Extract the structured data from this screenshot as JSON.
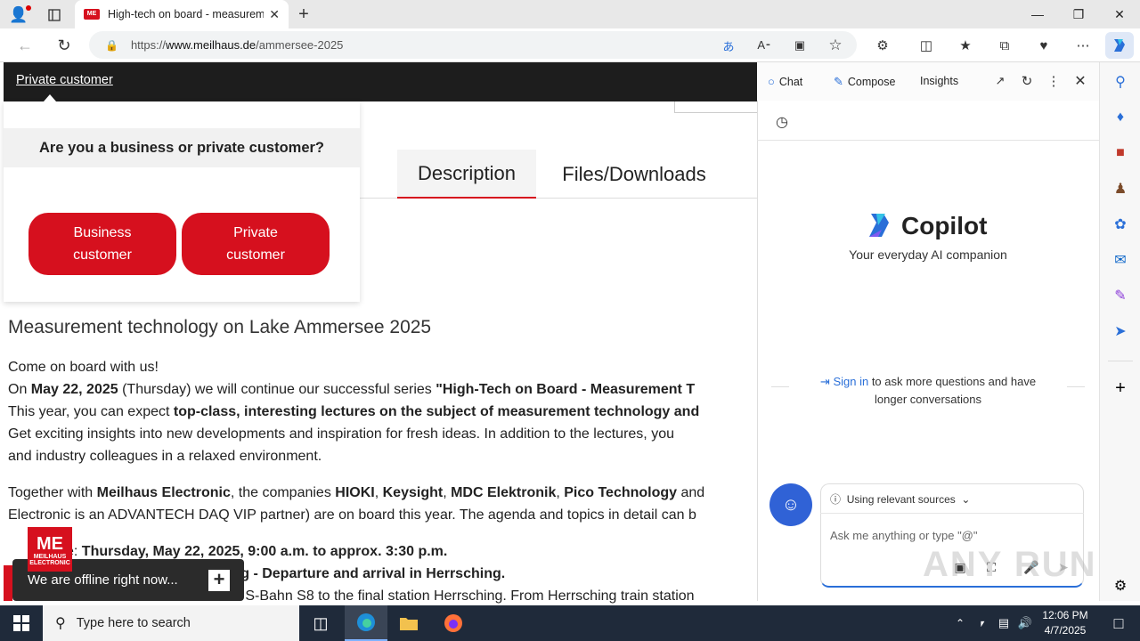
{
  "browser": {
    "tab_title": "High-tech on board - measurem",
    "favicon_text": "ME",
    "url_prefix": "https://",
    "url_domain": "www.meilhaus.de",
    "url_path": "/ammersee-2025"
  },
  "page": {
    "private_customer_link": "Private customer",
    "popup_question": "Are you a business or private customer?",
    "business_btn": [
      "Business",
      "customer"
    ],
    "private_btn": [
      "Private",
      "customer"
    ],
    "tabs": [
      "Description",
      "Files/Downloads"
    ],
    "heading": "Measurement technology on Lake Ammersee 2025",
    "para1_l1": "Come on board with us!",
    "para1_l2": [
      {
        "t": "On ",
        "b": false
      },
      {
        "t": "May 22, 2025",
        "b": true
      },
      {
        "t": " (Thursday) we will continue our successful series ",
        "b": false
      },
      {
        "t": "\"High-Tech on Board - Measurement T",
        "b": true
      }
    ],
    "para1_l3": [
      {
        "t": "This year, you can expect ",
        "b": false
      },
      {
        "t": "top-class, interesting lectures on the subject of measurement technology and",
        "b": true
      }
    ],
    "para1_l4": "Get exciting insights into new developments and inspiration for fresh ideas. In addition to the lectures, you",
    "para1_l5": "and industry colleagues in a relaxed environment.",
    "para2_l1": [
      {
        "t": "Together with ",
        "b": false
      },
      {
        "t": "Meilhaus Electronic",
        "b": true
      },
      {
        "t": ", the companies ",
        "b": false
      },
      {
        "t": "HIOKI",
        "b": true
      },
      {
        "t": ", ",
        "b": false
      },
      {
        "t": "Keysight",
        "b": true
      },
      {
        "t": ", ",
        "b": false
      },
      {
        "t": "MDC Elektronik",
        "b": true
      },
      {
        "t": ", ",
        "b": false
      },
      {
        "t": "Pico Technology",
        "b": true
      },
      {
        "t": " and",
        "b": false
      }
    ],
    "para2_l2": "Electronic is an ADVANTECH DAQ VIP partner) are on board this year. The agenda and topics in detail can b",
    "para3_l1": [
      {
        "t": "e: ",
        "b": false
      },
      {
        "t": "Thursday, May 22, 2025, 9:00 a.m. to approx. 3:30 p.m.",
        "b": true
      }
    ],
    "para3_l2": "ing - Departure and arrival in Herrsching.",
    "para3_l3": "e S-Bahn S8 to the final station Herrsching. From Herrsching train station",
    "chat_offline": "We are offline right now...",
    "logo_mark": "ME",
    "logo_lines": [
      "MEILHAUS",
      "ELECTRONIC"
    ]
  },
  "copilot": {
    "tabs": [
      "Chat",
      "Compose",
      "Insights"
    ],
    "title": "Copilot",
    "subtitle": "Your everyday AI companion",
    "signin_link": "Sign in",
    "signin_rest": "to ask more questions and have",
    "signin_rest2": "longer conversations",
    "sources": "Using relevant sources",
    "placeholder": "Ask me anything or type \"@\""
  },
  "taskbar": {
    "search_placeholder": "Type here to search",
    "time": "12:06 PM",
    "date": "4/7/2025"
  },
  "watermark": "ANY RUN"
}
